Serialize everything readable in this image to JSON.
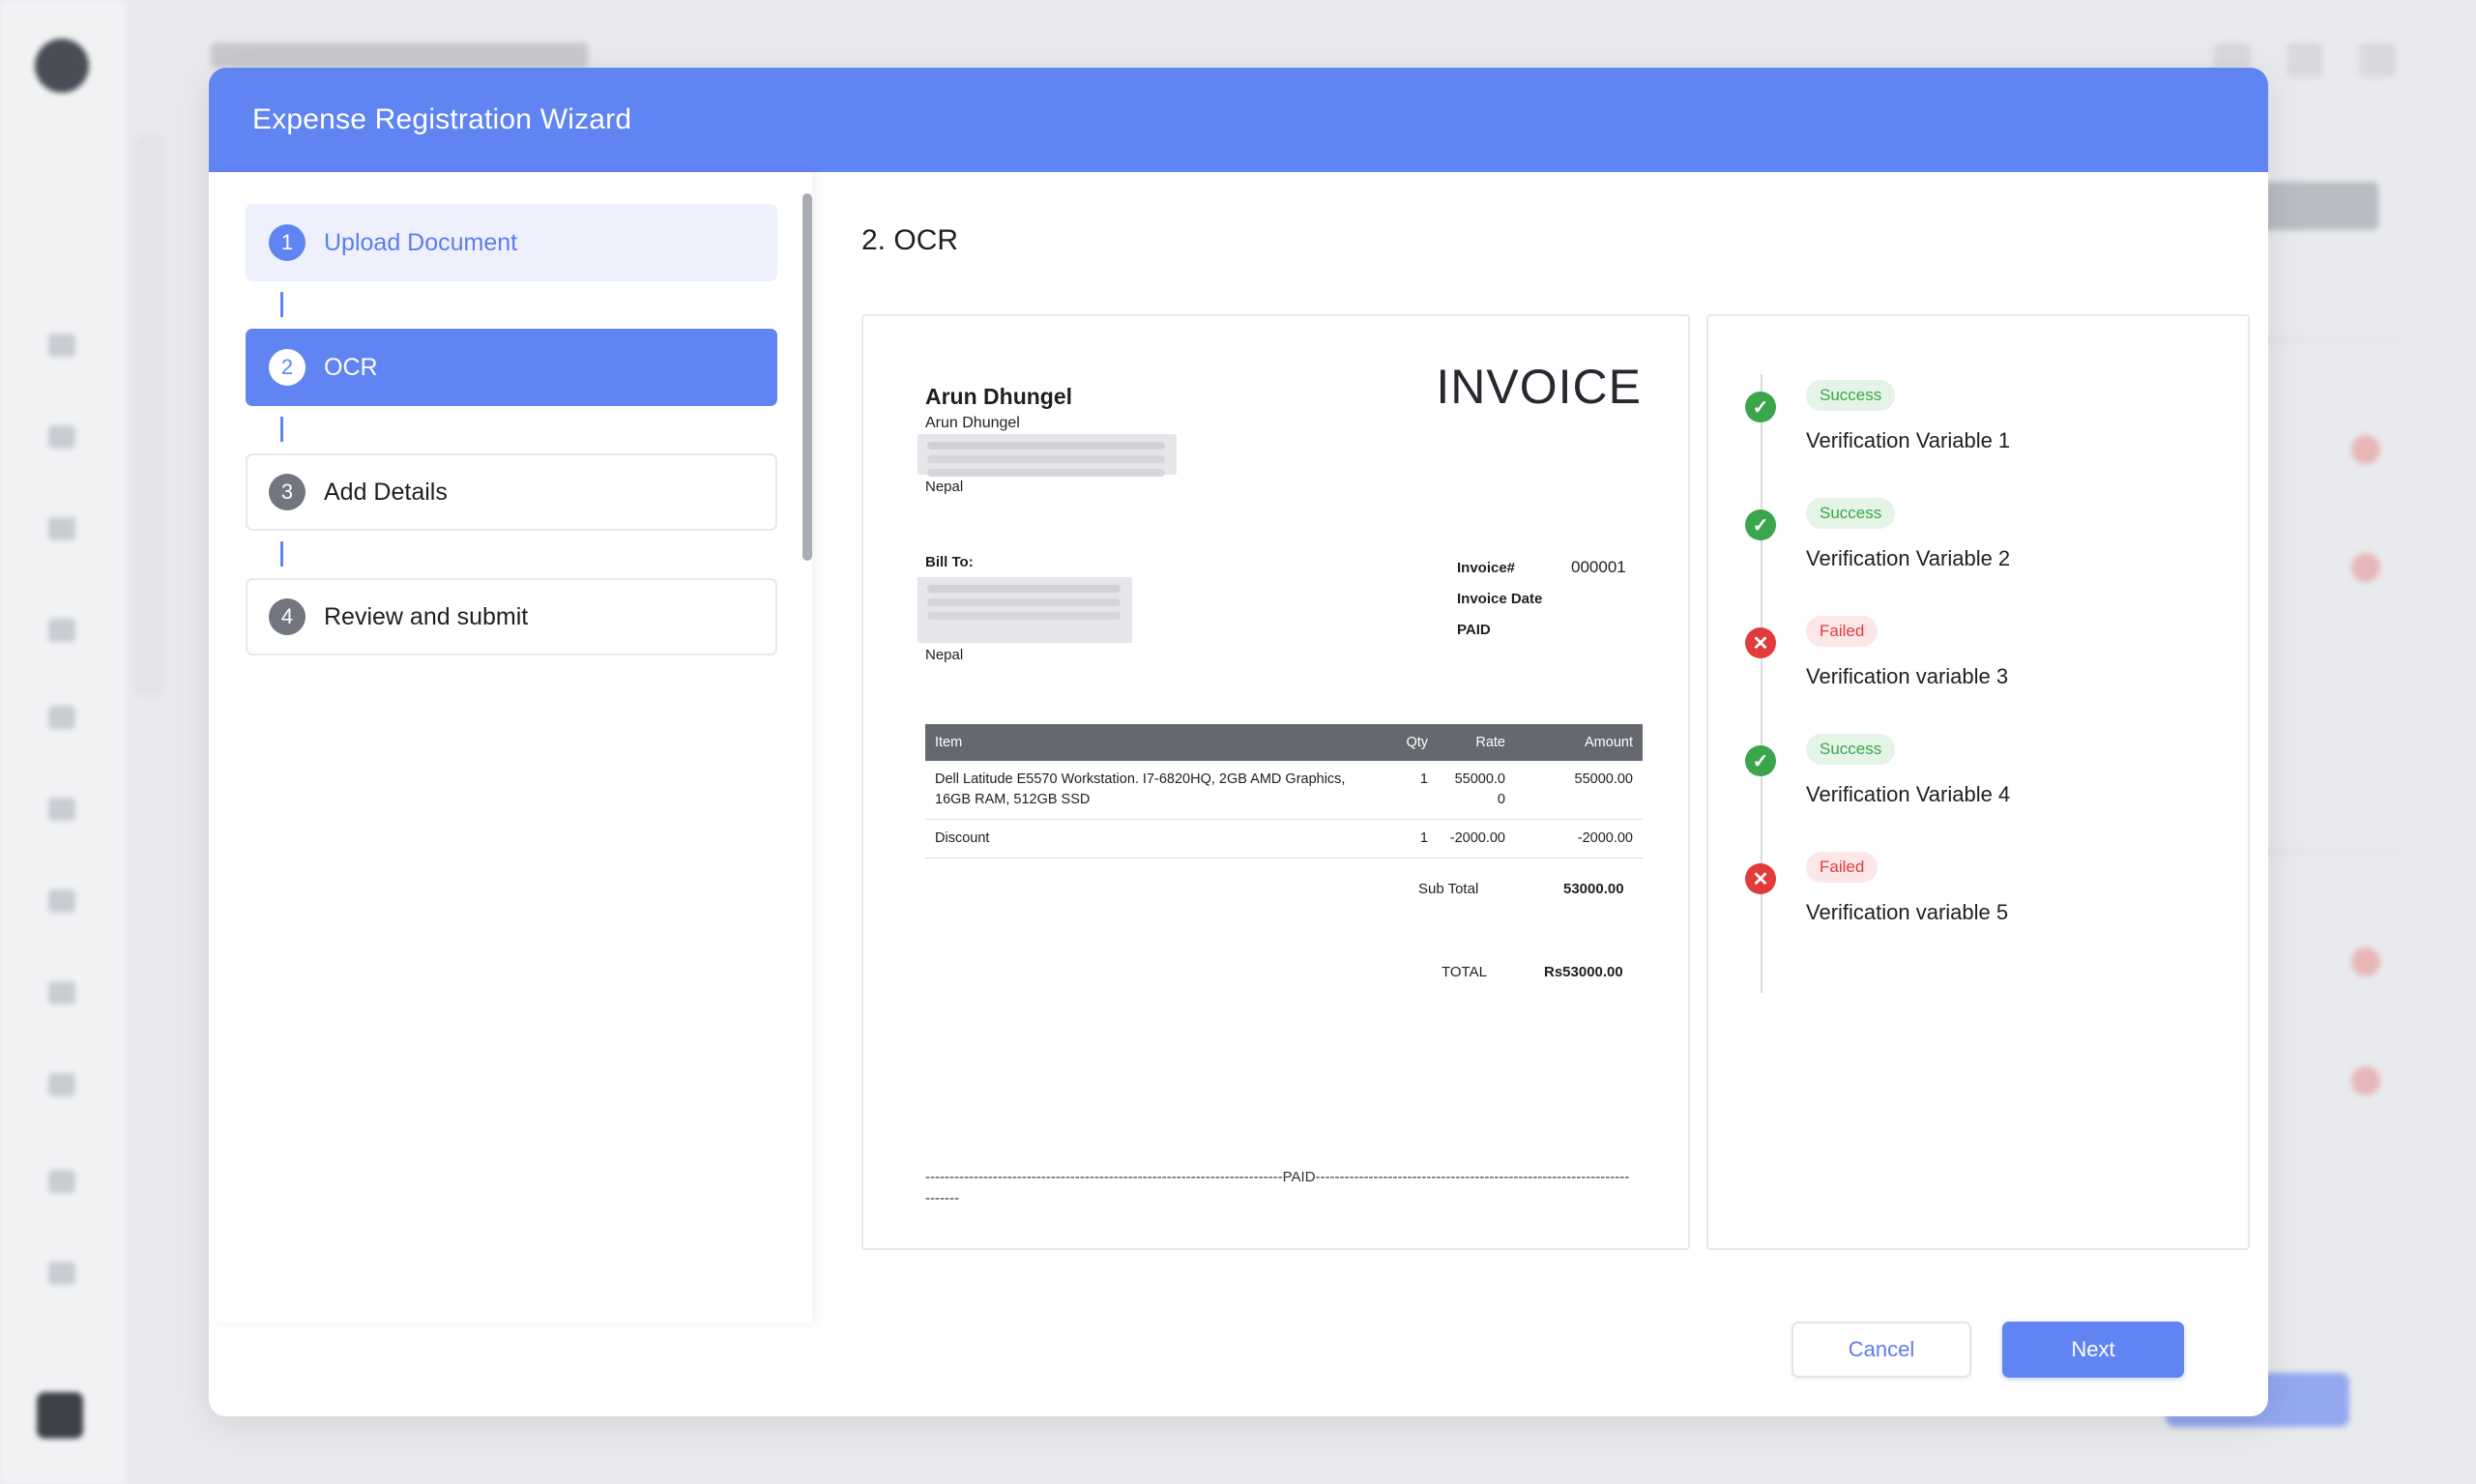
{
  "modal": {
    "title": "Expense Registration Wizard",
    "section_title": "2. OCR"
  },
  "steps": [
    {
      "number": "1",
      "label": "Upload Document",
      "state": "done"
    },
    {
      "number": "2",
      "label": "OCR",
      "state": "active"
    },
    {
      "number": "3",
      "label": "Add Details",
      "state": "pending"
    },
    {
      "number": "4",
      "label": "Review and submit",
      "state": "pending"
    }
  ],
  "invoice": {
    "company_name": "Arun Dhungel",
    "company_subname": "Arun Dhungel",
    "company_country": "Nepal",
    "heading": "INVOICE",
    "bill_to_label": "Bill To:",
    "bill_to_country": "Nepal",
    "invoice_no_label": "Invoice#",
    "invoice_no": "000001",
    "invoice_date_label": "Invoice Date",
    "status_label": "PAID",
    "table": {
      "headers": {
        "item": "Item",
        "qty": "Qty",
        "rate": "Rate",
        "amount": "Amount"
      },
      "rows": [
        {
          "item": "Dell Latitude E5570 Workstation. I7-6820HQ, 2GB AMD Graphics, 16GB RAM, 512GB SSD",
          "qty": "1",
          "rate": "55000.00",
          "amount": "55000.00"
        },
        {
          "item": "Discount",
          "qty": "1",
          "rate": "-2000.00",
          "amount": "-2000.00"
        }
      ]
    },
    "subtotal_label": "Sub Total",
    "subtotal_value": "53000.00",
    "total_label": "TOTAL",
    "total_value": "Rs53000.00",
    "paid_line": "--------------------------------------------------------------------------PAID------------------------------------------------------------------------"
  },
  "verifications": [
    {
      "status": "Success",
      "label": "Verification Variable 1",
      "ok": true
    },
    {
      "status": "Success",
      "label": "Verification Variable 2",
      "ok": true
    },
    {
      "status": "Failed",
      "label": "Verification variable 3",
      "ok": false
    },
    {
      "status": "Success",
      "label": "Verification Variable 4",
      "ok": true
    },
    {
      "status": "Failed",
      "label": "Verification variable 5",
      "ok": false
    }
  ],
  "buttons": {
    "cancel": "Cancel",
    "next": "Next"
  },
  "icons": {
    "check": "✓",
    "cross": "✕"
  },
  "colors": {
    "accent": "#6084f2",
    "success": "#3aa54a",
    "failure": "#e23b3b"
  }
}
